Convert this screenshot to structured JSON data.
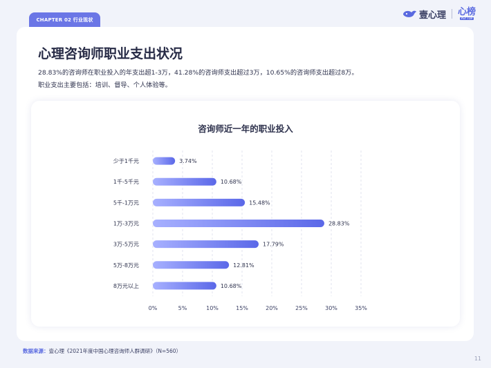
{
  "header": {
    "chapter": "CHAPTER 02  行业现状",
    "brand": "壹心理",
    "brand2": "心榜",
    "brand2_sub": "PSY TOP"
  },
  "title": "心理咨询师职业支出状况",
  "description": [
    "28.83%的咨询师在职业投入的年支出超1-3万，41.28%的咨询师支出超过3万，10.65%的咨询师支出超过8万。",
    "职业支出主要包括：培训、督导、个人体验等。"
  ],
  "source": {
    "label": "数据来源：",
    "text": "壹心理《2021年度中国心理咨询师人群调研》（N=560）"
  },
  "page_number": "11",
  "colors": {
    "accent": "#6b76e6",
    "bar_start": "#a7b0ff",
    "bar_end": "#5b68e8"
  },
  "chart_data": {
    "type": "bar",
    "orientation": "horizontal",
    "title": "咨询师近一年的职业投入",
    "categories": [
      "少于1千元",
      "1千-5千元",
      "5千-1万元",
      "1万-3万元",
      "3万-5万元",
      "5万-8万元",
      "8万元以上"
    ],
    "values": [
      3.74,
      10.68,
      15.48,
      28.83,
      17.79,
      12.81,
      10.68
    ],
    "value_labels": [
      "3.74%",
      "10.68%",
      "15.48%",
      "28.83%",
      "17.79%",
      "12.81%",
      "10.68%"
    ],
    "xlim": [
      0,
      35
    ],
    "xticks": [
      "0%",
      "5%",
      "10%",
      "15%",
      "20%",
      "25%",
      "30%",
      "35%"
    ],
    "grid": "vertical dashed"
  }
}
